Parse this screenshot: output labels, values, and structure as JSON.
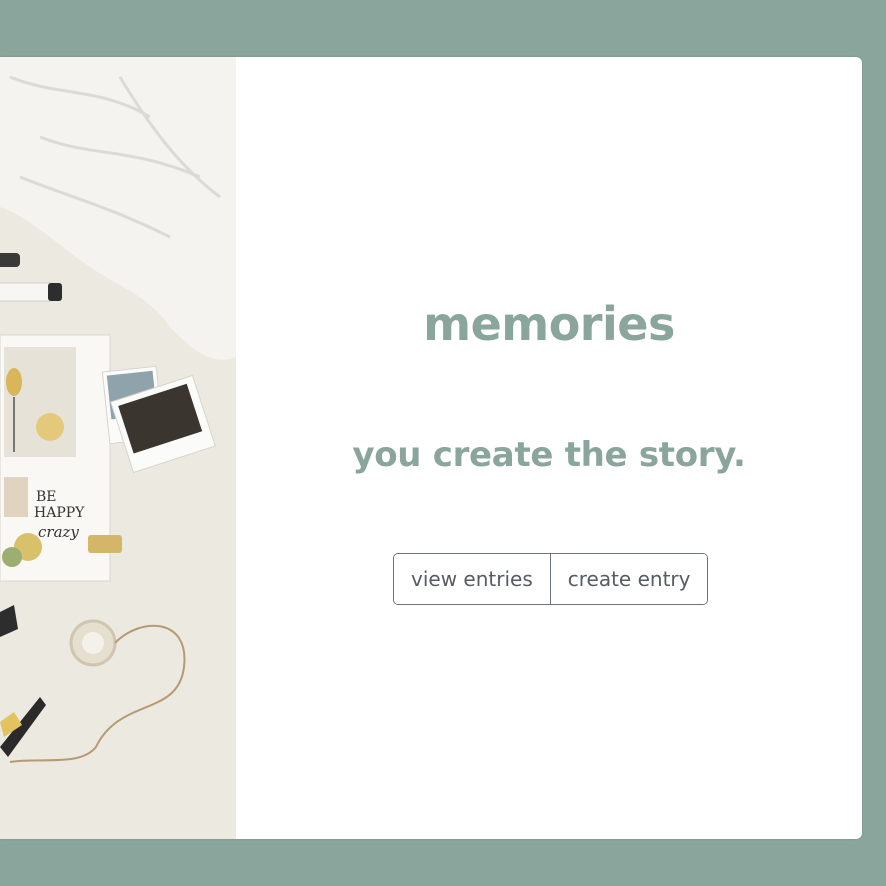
{
  "hero": {
    "title": "memories",
    "tagline": "you create the story."
  },
  "actions": {
    "view_label": "view entries",
    "create_label": "create entry"
  },
  "photo": {
    "sticker_line1": "BE",
    "sticker_line2": "HAPPY",
    "sticker_line3": "crazy"
  },
  "colors": {
    "accent": "#8aa59b",
    "page_bg": "#8aa59b",
    "card_bg": "#ffffff",
    "button_text": "#555d63",
    "button_border": "#6c757d"
  }
}
